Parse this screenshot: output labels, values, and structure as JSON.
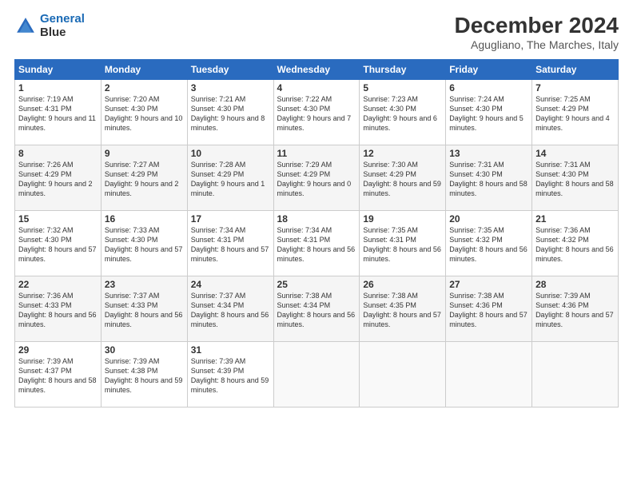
{
  "logo": {
    "line1": "General",
    "line2": "Blue"
  },
  "title": "December 2024",
  "subtitle": "Agugliano, The Marches, Italy",
  "days_header": [
    "Sunday",
    "Monday",
    "Tuesday",
    "Wednesday",
    "Thursday",
    "Friday",
    "Saturday"
  ],
  "weeks": [
    [
      {
        "day": "1",
        "sunrise": "7:19 AM",
        "sunset": "4:31 PM",
        "daylight": "9 hours and 11 minutes."
      },
      {
        "day": "2",
        "sunrise": "7:20 AM",
        "sunset": "4:30 PM",
        "daylight": "9 hours and 10 minutes."
      },
      {
        "day": "3",
        "sunrise": "7:21 AM",
        "sunset": "4:30 PM",
        "daylight": "9 hours and 8 minutes."
      },
      {
        "day": "4",
        "sunrise": "7:22 AM",
        "sunset": "4:30 PM",
        "daylight": "9 hours and 7 minutes."
      },
      {
        "day": "5",
        "sunrise": "7:23 AM",
        "sunset": "4:30 PM",
        "daylight": "9 hours and 6 minutes."
      },
      {
        "day": "6",
        "sunrise": "7:24 AM",
        "sunset": "4:30 PM",
        "daylight": "9 hours and 5 minutes."
      },
      {
        "day": "7",
        "sunrise": "7:25 AM",
        "sunset": "4:29 PM",
        "daylight": "9 hours and 4 minutes."
      }
    ],
    [
      {
        "day": "8",
        "sunrise": "7:26 AM",
        "sunset": "4:29 PM",
        "daylight": "9 hours and 2 minutes."
      },
      {
        "day": "9",
        "sunrise": "7:27 AM",
        "sunset": "4:29 PM",
        "daylight": "9 hours and 2 minutes."
      },
      {
        "day": "10",
        "sunrise": "7:28 AM",
        "sunset": "4:29 PM",
        "daylight": "9 hours and 1 minute."
      },
      {
        "day": "11",
        "sunrise": "7:29 AM",
        "sunset": "4:29 PM",
        "daylight": "9 hours and 0 minutes."
      },
      {
        "day": "12",
        "sunrise": "7:30 AM",
        "sunset": "4:29 PM",
        "daylight": "8 hours and 59 minutes."
      },
      {
        "day": "13",
        "sunrise": "7:31 AM",
        "sunset": "4:30 PM",
        "daylight": "8 hours and 58 minutes."
      },
      {
        "day": "14",
        "sunrise": "7:31 AM",
        "sunset": "4:30 PM",
        "daylight": "8 hours and 58 minutes."
      }
    ],
    [
      {
        "day": "15",
        "sunrise": "7:32 AM",
        "sunset": "4:30 PM",
        "daylight": "8 hours and 57 minutes."
      },
      {
        "day": "16",
        "sunrise": "7:33 AM",
        "sunset": "4:30 PM",
        "daylight": "8 hours and 57 minutes."
      },
      {
        "day": "17",
        "sunrise": "7:34 AM",
        "sunset": "4:31 PM",
        "daylight": "8 hours and 57 minutes."
      },
      {
        "day": "18",
        "sunrise": "7:34 AM",
        "sunset": "4:31 PM",
        "daylight": "8 hours and 56 minutes."
      },
      {
        "day": "19",
        "sunrise": "7:35 AM",
        "sunset": "4:31 PM",
        "daylight": "8 hours and 56 minutes."
      },
      {
        "day": "20",
        "sunrise": "7:35 AM",
        "sunset": "4:32 PM",
        "daylight": "8 hours and 56 minutes."
      },
      {
        "day": "21",
        "sunrise": "7:36 AM",
        "sunset": "4:32 PM",
        "daylight": "8 hours and 56 minutes."
      }
    ],
    [
      {
        "day": "22",
        "sunrise": "7:36 AM",
        "sunset": "4:33 PM",
        "daylight": "8 hours and 56 minutes."
      },
      {
        "day": "23",
        "sunrise": "7:37 AM",
        "sunset": "4:33 PM",
        "daylight": "8 hours and 56 minutes."
      },
      {
        "day": "24",
        "sunrise": "7:37 AM",
        "sunset": "4:34 PM",
        "daylight": "8 hours and 56 minutes."
      },
      {
        "day": "25",
        "sunrise": "7:38 AM",
        "sunset": "4:34 PM",
        "daylight": "8 hours and 56 minutes."
      },
      {
        "day": "26",
        "sunrise": "7:38 AM",
        "sunset": "4:35 PM",
        "daylight": "8 hours and 57 minutes."
      },
      {
        "day": "27",
        "sunrise": "7:38 AM",
        "sunset": "4:36 PM",
        "daylight": "8 hours and 57 minutes."
      },
      {
        "day": "28",
        "sunrise": "7:39 AM",
        "sunset": "4:36 PM",
        "daylight": "8 hours and 57 minutes."
      }
    ],
    [
      {
        "day": "29",
        "sunrise": "7:39 AM",
        "sunset": "4:37 PM",
        "daylight": "8 hours and 58 minutes."
      },
      {
        "day": "30",
        "sunrise": "7:39 AM",
        "sunset": "4:38 PM",
        "daylight": "8 hours and 59 minutes."
      },
      {
        "day": "31",
        "sunrise": "7:39 AM",
        "sunset": "4:39 PM",
        "daylight": "8 hours and 59 minutes."
      },
      null,
      null,
      null,
      null
    ]
  ]
}
